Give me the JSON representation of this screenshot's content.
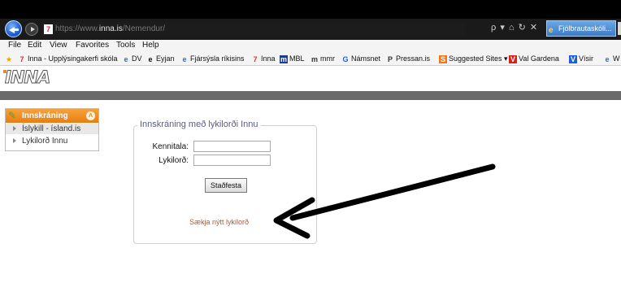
{
  "browser": {
    "url_prefix": "https://www.",
    "url_host": "inna.is",
    "url_path": "/Nemendur/",
    "address_tools": "ρ ▾ ⌂ ↻ ✕",
    "tab_title": "Fjölbrautaskóli...",
    "menu": [
      "File",
      "Edit",
      "View",
      "Favorites",
      "Tools",
      "Help"
    ],
    "favorites": [
      {
        "icon": "7",
        "label": "Inna - Upplýsingakerfi skóla"
      },
      {
        "icon": "e",
        "label": "DV"
      },
      {
        "icon": "e",
        "label": "Eyjan"
      },
      {
        "icon": "e",
        "label": "Fjársýsla ríkisins"
      },
      {
        "icon": "7",
        "label": "Inna"
      },
      {
        "icon": "m",
        "label": "MBL"
      },
      {
        "icon": "m",
        "label": "mmr"
      },
      {
        "icon": "G",
        "label": "Námsnet"
      },
      {
        "icon": "P",
        "label": "Pressan.is"
      },
      {
        "icon": "S",
        "label": "Suggested Sites ▾"
      },
      {
        "icon": "V",
        "label": "Val Gardena"
      },
      {
        "icon": "V",
        "label": "Vísir"
      },
      {
        "icon": "e",
        "label": "W"
      }
    ]
  },
  "site": {
    "logo": "INNA"
  },
  "sidebar": {
    "header": "Innskráning",
    "items": [
      {
        "label": "Íslykill - ísland.is"
      },
      {
        "label": "Lykilorð Innu"
      }
    ]
  },
  "login": {
    "legend": "Innskráning með lykilorði Innu",
    "kennitala_label": "Kennitala:",
    "password_label": "Lykilorð:",
    "kennitala_value": "",
    "password_value": "",
    "submit_label": "Staðfesta",
    "reset_link": "Sækja nýtt lykilorð"
  },
  "colors": {
    "sidebar_header": "#e87d10",
    "band": "#6a6a6a",
    "reset_link": "#b5572d",
    "legend": "#5a5a8a"
  }
}
